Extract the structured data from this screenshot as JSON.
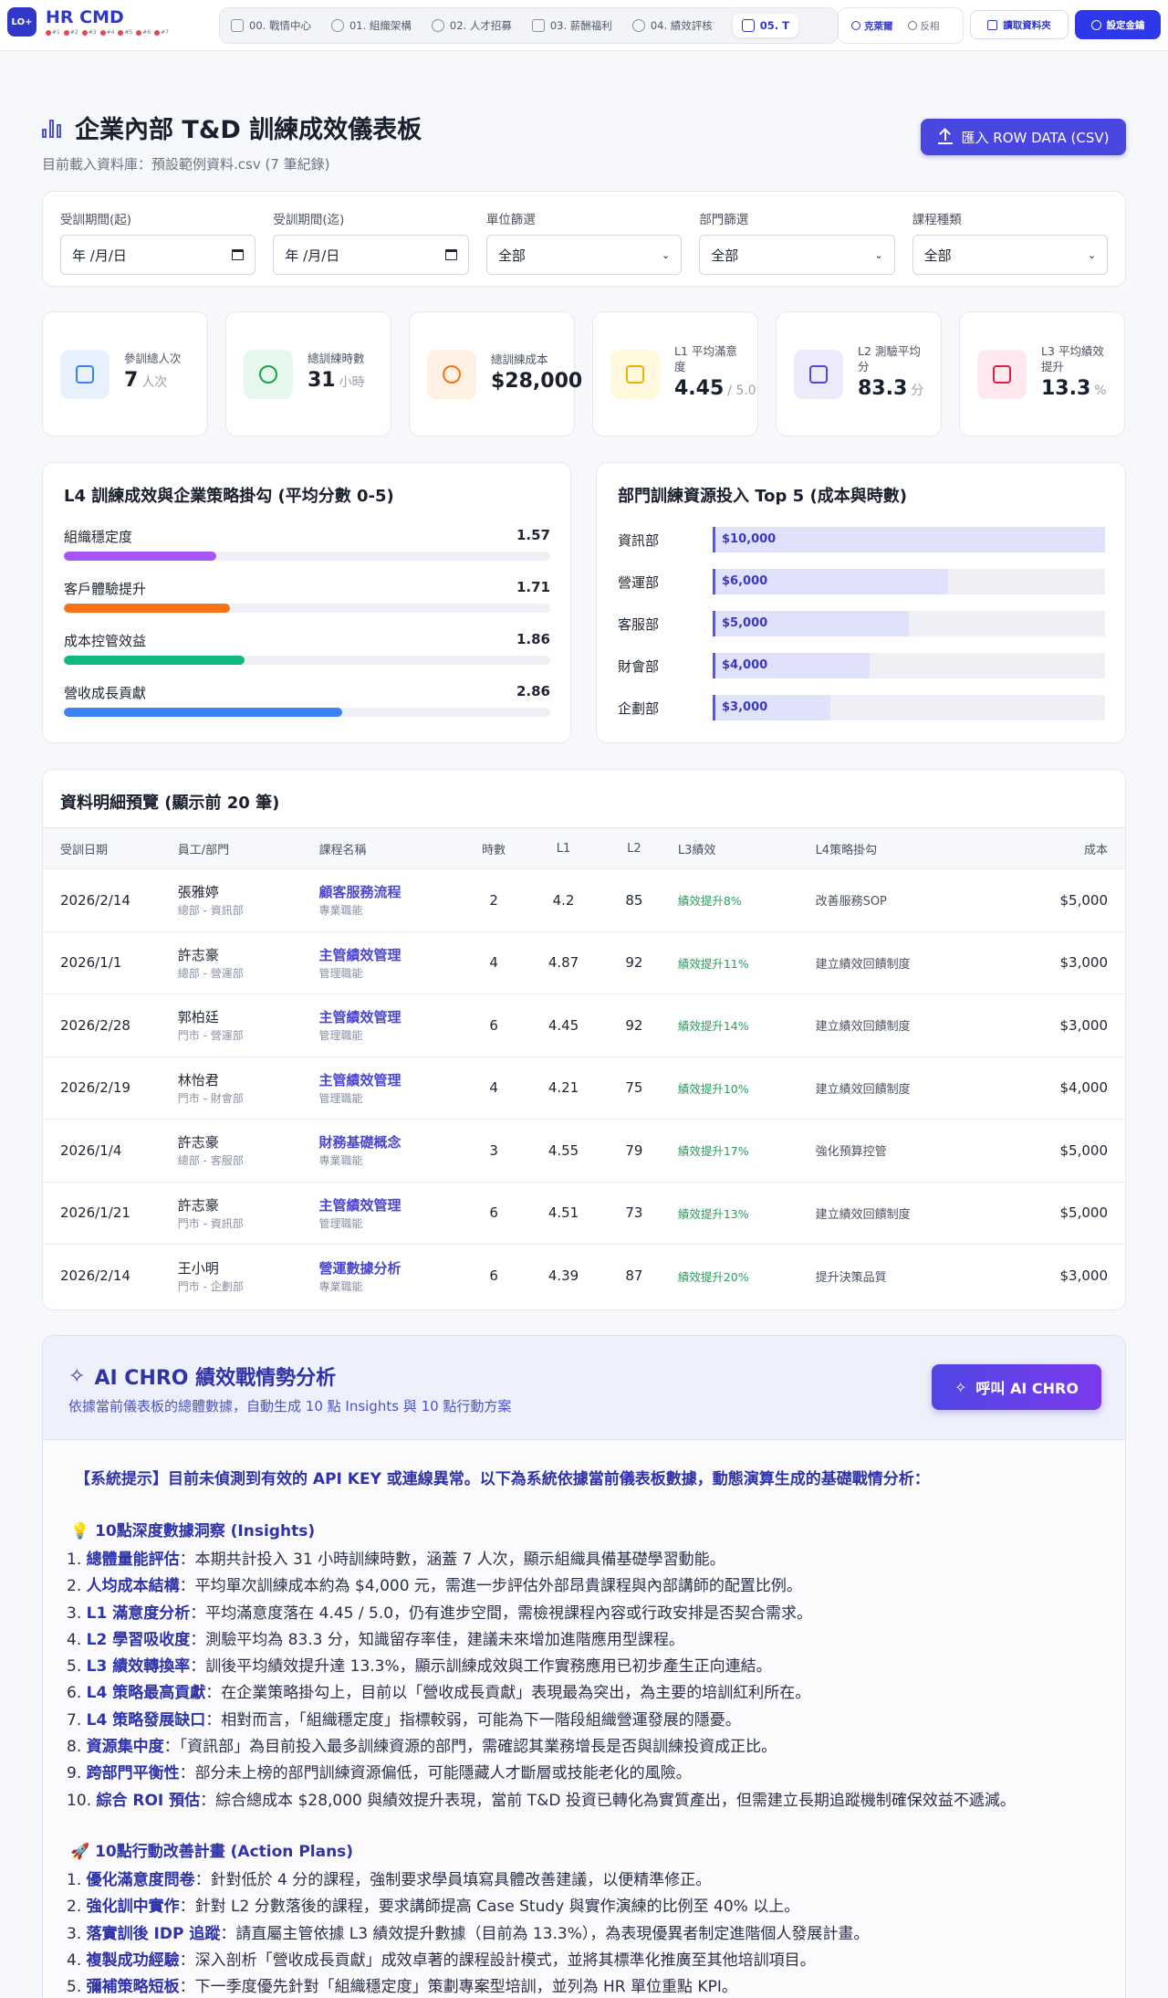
{
  "brand": {
    "logo": "LO+",
    "title": "HR CMD",
    "dots": [
      "#1",
      "#2",
      "#3",
      "#4",
      "#5",
      "#6",
      "#7"
    ]
  },
  "nav": {
    "items": [
      {
        "label": "00. 戰情中心",
        "icon": "grid-icon"
      },
      {
        "label": "01. 組織架構",
        "icon": "users-icon"
      },
      {
        "label": "02. 人才招募",
        "icon": "user-plus-icon"
      },
      {
        "label": "03. 薪酬福利",
        "icon": "wallet-icon"
      },
      {
        "label": "04. 績效評核",
        "icon": "target-icon"
      },
      {
        "label": "05. T",
        "icon": "graduation-icon"
      }
    ],
    "lang": [
      {
        "label": "克萊爾",
        "active": true
      },
      {
        "label": "反相",
        "active": false
      }
    ],
    "folder_button": "讀取資料夾",
    "key_button": "設定金鑰"
  },
  "header": {
    "title": "企業內部 T&D 訓練成效儀表板",
    "subtitle": "目前載入資料庫：預設範例資料.csv (7 筆紀錄)",
    "import_button": "匯入 ROW DATA (CSV)"
  },
  "filters": [
    {
      "label": "受訓期間(起)",
      "value": "年 /月/日",
      "kind": "date"
    },
    {
      "label": "受訓期間(迄)",
      "value": "年 /月/日",
      "kind": "date"
    },
    {
      "label": "單位篩選",
      "value": "全部",
      "kind": "select"
    },
    {
      "label": "部門篩選",
      "value": "全部",
      "kind": "select"
    },
    {
      "label": "課程種類",
      "value": "全部",
      "kind": "select"
    }
  ],
  "kpis": [
    {
      "label": "參訓總人次",
      "value": "7",
      "unit": "人次",
      "icon": "users-icon",
      "bg": "#e8f1fe",
      "fg": "#3b82f6"
    },
    {
      "label": "總訓練時數",
      "value": "31",
      "unit": "小時",
      "icon": "clock-icon",
      "bg": "#e6f7ee",
      "fg": "#16a34a"
    },
    {
      "label": "總訓練成本",
      "value": "$28,000",
      "unit": "",
      "icon": "dollar-icon",
      "bg": "#fff1e4",
      "fg": "#f97316"
    },
    {
      "label": "L1 平均滿意度",
      "value": "4.45",
      "unit": "/ 5.0",
      "icon": "star-icon",
      "bg": "#fff8dc",
      "fg": "#eab308"
    },
    {
      "label": "L2 測驗平均分",
      "value": "83.3",
      "unit": "分",
      "icon": "bar-chart-icon",
      "bg": "#ecebfc",
      "fg": "#4f46e5"
    },
    {
      "label": "L3 平均績效提升",
      "value": "13.3",
      "unit": "%",
      "icon": "trend-up-icon",
      "bg": "#fde9ee",
      "fg": "#e11d48"
    }
  ],
  "l4_panel": {
    "title": "L4 訓練成效與企業策略掛勾 (平均分數 0-5)",
    "max": 5,
    "items": [
      {
        "label": "組織穩定度",
        "value": 1.57,
        "display": "1.57",
        "color": "#a855f7"
      },
      {
        "label": "客戶體驗提升",
        "value": 1.71,
        "display": "1.71",
        "color": "#f97316"
      },
      {
        "label": "成本控管效益",
        "value": 1.86,
        "display": "1.86",
        "color": "#10b981"
      },
      {
        "label": "營收成長貢獻",
        "value": 2.86,
        "display": "2.86",
        "color": "#3b82f6"
      }
    ]
  },
  "top5_panel": {
    "title": "部門訓練資源投入 Top 5 (成本與時數)",
    "max": 10000,
    "items": [
      {
        "dept": "資訊部",
        "value": 10000,
        "display": "$10,000"
      },
      {
        "dept": "營運部",
        "value": 6000,
        "display": "$6,000"
      },
      {
        "dept": "客服部",
        "value": 5000,
        "display": "$5,000"
      },
      {
        "dept": "財會部",
        "value": 4000,
        "display": "$4,000"
      },
      {
        "dept": "企劃部",
        "value": 3000,
        "display": "$3,000"
      }
    ]
  },
  "table": {
    "title": "資料明細預覽 (顯示前 20 筆)",
    "columns": [
      "受訓日期",
      "員工/部門",
      "課程名稱",
      "時數",
      "L1",
      "L2",
      "L3績效",
      "L4策略掛勾",
      "成本"
    ],
    "rows": [
      {
        "date": "2026/2/14",
        "name": "張雅婷",
        "dept": "總部 - 資訊部",
        "course": "顧客服務流程",
        "ctype": "專業職能",
        "hours": "2",
        "l1": "4.2",
        "l2": "85",
        "l3": "績效提升8%",
        "l4": "改善服務SOP",
        "cost": "$5,000"
      },
      {
        "date": "2026/1/1",
        "name": "許志豪",
        "dept": "總部 - 營運部",
        "course": "主管績效管理",
        "ctype": "管理職能",
        "hours": "4",
        "l1": "4.87",
        "l2": "92",
        "l3": "績效提升11%",
        "l4": "建立績效回饋制度",
        "cost": "$3,000"
      },
      {
        "date": "2026/2/28",
        "name": "郭柏廷",
        "dept": "門市 - 營運部",
        "course": "主管績效管理",
        "ctype": "管理職能",
        "hours": "6",
        "l1": "4.45",
        "l2": "92",
        "l3": "績效提升14%",
        "l4": "建立績效回饋制度",
        "cost": "$3,000"
      },
      {
        "date": "2026/2/19",
        "name": "林怡君",
        "dept": "門市 - 財會部",
        "course": "主管績效管理",
        "ctype": "管理職能",
        "hours": "4",
        "l1": "4.21",
        "l2": "75",
        "l3": "績效提升10%",
        "l4": "建立績效回饋制度",
        "cost": "$4,000"
      },
      {
        "date": "2026/1/4",
        "name": "許志豪",
        "dept": "總部 - 客服部",
        "course": "財務基礎概念",
        "ctype": "專業職能",
        "hours": "3",
        "l1": "4.55",
        "l2": "79",
        "l3": "績效提升17%",
        "l4": "強化預算控管",
        "cost": "$5,000"
      },
      {
        "date": "2026/1/21",
        "name": "許志豪",
        "dept": "門市 - 資訊部",
        "course": "主管績效管理",
        "ctype": "管理職能",
        "hours": "6",
        "l1": "4.51",
        "l2": "73",
        "l3": "績效提升13%",
        "l4": "建立績效回饋制度",
        "cost": "$5,000"
      },
      {
        "date": "2026/2/14",
        "name": "王小明",
        "dept": "門市 - 企劃部",
        "course": "營運數據分析",
        "ctype": "專業職能",
        "hours": "6",
        "l1": "4.39",
        "l2": "87",
        "l3": "績效提升20%",
        "l4": "提升決策品質",
        "cost": "$3,000"
      }
    ]
  },
  "ai": {
    "title": "AI CHRO 績效戰情勢分析",
    "subtitle": "依據當前儀表板的總體數據，自動生成 10 點 Insights 與 10 點行動方案",
    "button": "呼叫 AI CHRO",
    "notice": "【系統提示】目前未偵測到有效的 API KEY 或連線異常。以下為系統依據當前儀表板數據，動態演算生成的基礎戰情分析：",
    "insights_title": "💡 10點深度數據洞察 (Insights)",
    "insights": [
      {
        "n": "1. ",
        "head": "總體量能評估",
        "body": "：本期共計投入 31 小時訓練時數，涵蓋 7 人次，顯示組織具備基礎學習動能。"
      },
      {
        "n": "2. ",
        "head": "人均成本結構",
        "body": "：平均單次訓練成本約為 $4,000 元，需進一步評估外部昂貴課程與內部講師的配置比例。"
      },
      {
        "n": "3. ",
        "head": "L1 滿意度分析",
        "body": "：平均滿意度落在 4.45 / 5.0，仍有進步空間，需檢視課程內容或行政安排是否契合需求。"
      },
      {
        "n": "4. ",
        "head": "L2 學習吸收度",
        "body": "：測驗平均為 83.3 分，知識留存率佳，建議未來增加進階應用型課程。"
      },
      {
        "n": "5. ",
        "head": "L3 績效轉換率",
        "body": "：訓後平均績效提升達 13.3%，顯示訓練成效與工作實務應用已初步產生正向連結。"
      },
      {
        "n": "6. ",
        "head": "L4 策略最高貢獻",
        "body": "：在企業策略掛勾上，目前以「營收成長貢獻」表現最為突出，為主要的培訓紅利所在。"
      },
      {
        "n": "7. ",
        "head": "L4 策略發展缺口",
        "body": "：相對而言，「組織穩定度」指標較弱，可能為下一階段組織營運發展的隱憂。"
      },
      {
        "n": "8. ",
        "head": "資源集中度",
        "body": "：「資訊部」為目前投入最多訓練資源的部門，需確認其業務增長是否與訓練投資成正比。"
      },
      {
        "n": "9. ",
        "head": "跨部門平衡性",
        "body": "：部分未上榜的部門訓練資源偏低，可能隱藏人才斷層或技能老化的風險。"
      },
      {
        "n": "10. ",
        "head": "綜合 ROI 預估",
        "body": "：綜合總成本 $28,000 與績效提升表現，當前 T&D 投資已轉化為實質產出，但需建立長期追蹤機制確保效益不遞減。"
      }
    ],
    "plans_title": "🚀 10點行動改善計畫 (Action Plans)",
    "plans": [
      {
        "n": "1. ",
        "head": "優化滿意度問卷",
        "body": "：針對低於 4 分的課程，強制要求學員填寫具體改善建議，以便精準修正。"
      },
      {
        "n": "2. ",
        "head": "強化訓中實作",
        "body": "：針對 L2 分數落後的課程，要求講師提高 Case Study 與實作演練的比例至 40% 以上。"
      },
      {
        "n": "3. ",
        "head": "落實訓後 IDP 追蹤",
        "body": "：請直屬主管依據 L3 績效提升數據（目前為 13.3%），為表現優異者制定進階個人發展計畫。"
      },
      {
        "n": "4. ",
        "head": "複製成功經驗",
        "body": "：深入剖析「營收成長貢獻」成效卓著的課程設計模式，並將其標準化推廣至其他培訓項目。"
      },
      {
        "n": "5. ",
        "head": "彌補策略短板",
        "body": "：下一季度優先針對「組織穩定度」策劃專案型培訓，並列為 HR 單位重點 KPI。"
      }
    ]
  }
}
